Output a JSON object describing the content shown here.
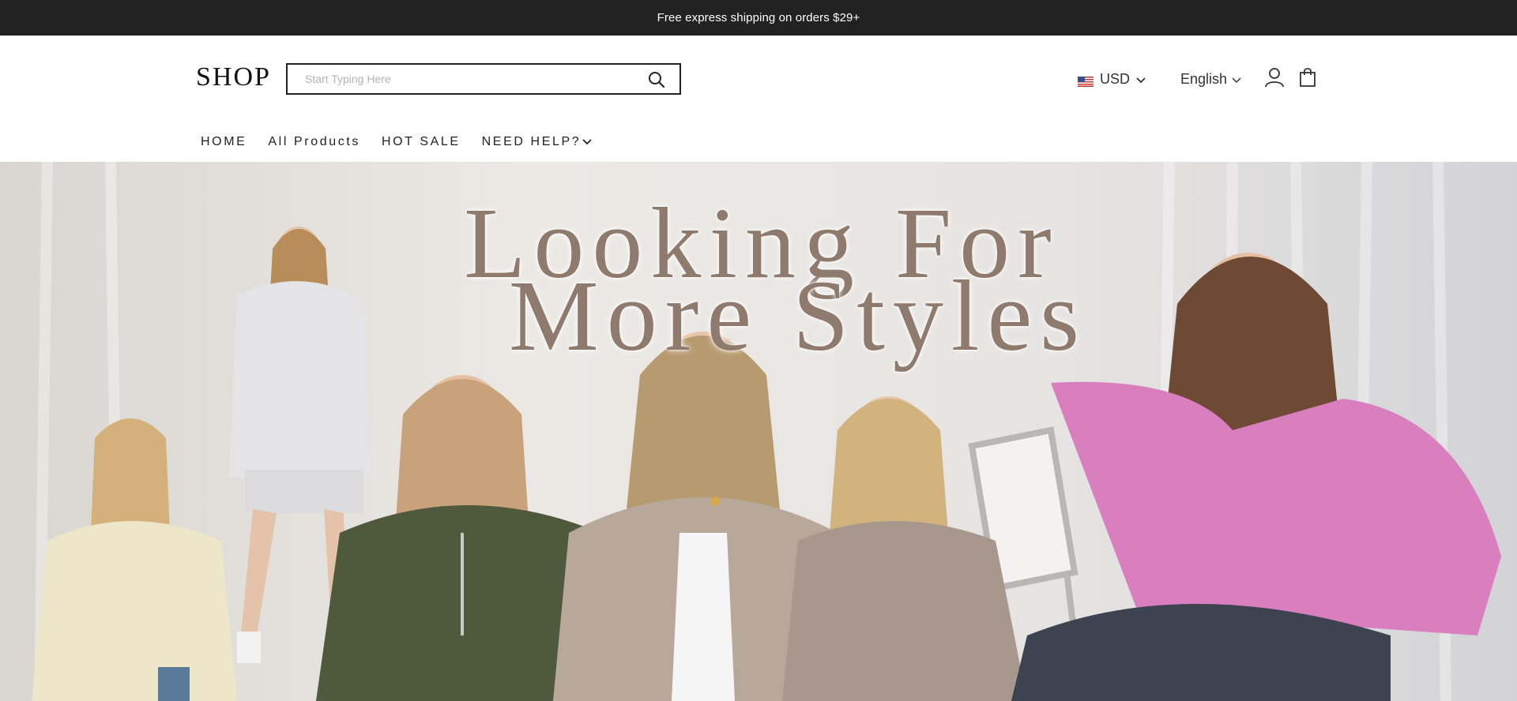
{
  "announcement": {
    "text": "Free express shipping on orders $29+"
  },
  "header": {
    "logo": "SHOP",
    "search": {
      "placeholder": "Start Typing Here",
      "value": ""
    },
    "currency": {
      "label": "USD",
      "flag": "us-flag-icon"
    },
    "language": {
      "label": "English"
    },
    "icons": [
      "search-icon",
      "account-icon",
      "cart-icon",
      "chevron-down-icon"
    ]
  },
  "nav": {
    "items": [
      {
        "label": "HOME"
      },
      {
        "label": "All Products"
      },
      {
        "label": "HOT SALE"
      },
      {
        "label": "NEED HELP?"
      }
    ]
  },
  "hero": {
    "headline_line1": "Looking For",
    "headline_line2": "More  Styles",
    "text_color": "#8f7b6e"
  },
  "colors": {
    "announcement_bg": "#222222",
    "accent_pink": "#d97fbf",
    "olive": "#4f5a3d",
    "taupe": "#a8978c",
    "cream": "#eee6c8"
  }
}
